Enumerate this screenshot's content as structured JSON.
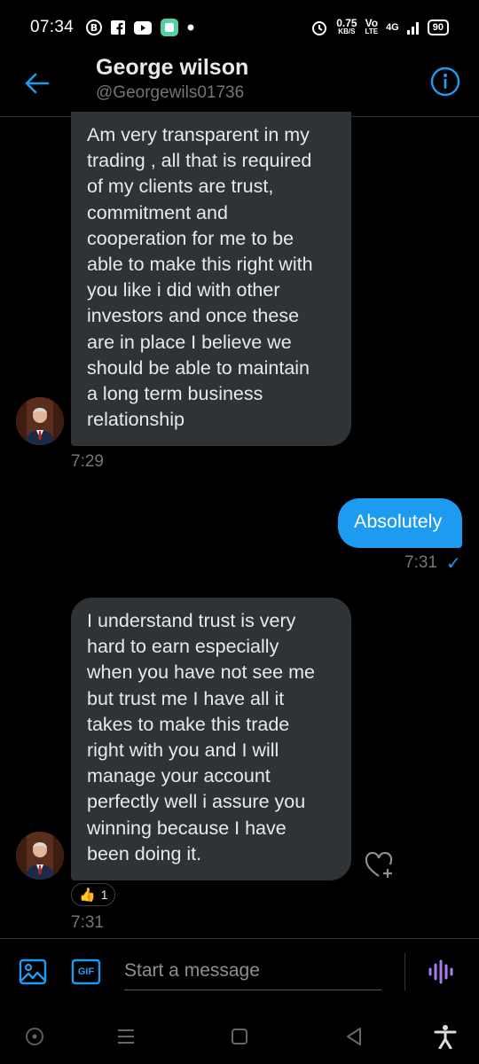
{
  "status_bar": {
    "time": "07:34",
    "network_speed_value": "0.75",
    "network_speed_unit": "KB/S",
    "volte_top": "Vo",
    "volte_bottom": "LTE",
    "network_type": "4G",
    "battery": "90"
  },
  "header": {
    "name": "George wilson",
    "handle": "@Georgewils01736"
  },
  "messages": [
    {
      "direction": "incoming",
      "text": "Am very transparent in my\ntrading , all that is required\nof my clients are trust,\ncommitment and\ncooperation for me to be\nable to make this right with\nyou like i did  with other\ninvestors and once these\nare in place I believe we\nshould be able to  maintain\na long term business\nrelationship",
      "time": "7:29"
    },
    {
      "direction": "outgoing",
      "text": "Absolutely",
      "time": "7:31",
      "status": "✓"
    },
    {
      "direction": "incoming",
      "text": "I understand trust is very\nhard to earn especially\nwhen you have not see me\nbut trust me I have all it\ntakes to make this trade\nright with you and I will\nmanage your account\nperfectly well i assure you\nwinning because I have\nbeen doing it.",
      "time": "7:31",
      "reaction_emoji": "👍",
      "reaction_count": "1"
    }
  ],
  "compose": {
    "placeholder": "Start a message",
    "gif_label": "GIF"
  },
  "colors": {
    "accent": "#1d9bf0",
    "bubble_incoming": "#2f3336",
    "voice_icon": "#a97df0",
    "background": "#000000"
  },
  "icons": {
    "back": "arrow-left-icon",
    "info": "info-icon",
    "image": "image-icon",
    "gif": "gif-icon",
    "voice": "voice-waveform-icon",
    "heart": "heart-plus-icon"
  }
}
